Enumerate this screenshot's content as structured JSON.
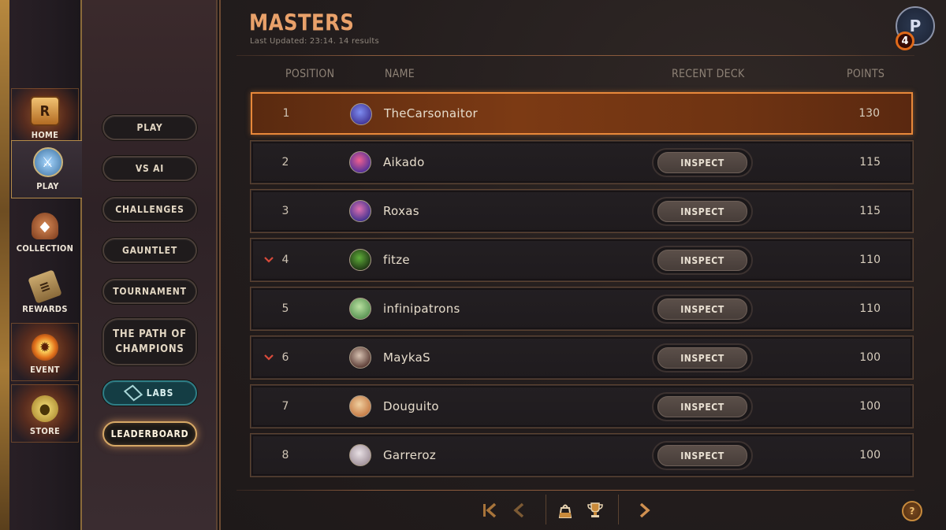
{
  "nav": {
    "items": [
      {
        "label": "HOME",
        "icon": "home-icon",
        "glyph": "R"
      },
      {
        "label": "PLAY",
        "icon": "play-shield-icon",
        "glyph": "⚔"
      },
      {
        "label": "COLLECTION",
        "icon": "collection-bag-icon",
        "glyph": "◆"
      },
      {
        "label": "REWARDS",
        "icon": "rewards-scroll-icon",
        "glyph": "≡"
      },
      {
        "label": "EVENT",
        "icon": "event-sun-icon",
        "glyph": "✹"
      },
      {
        "label": "STORE",
        "icon": "store-coins-icon",
        "glyph": "●"
      }
    ]
  },
  "submenu": {
    "play": "PLAY",
    "vs_ai": "VS AI",
    "challenges": "CHALLENGES",
    "gauntlet": "GAUNTLET",
    "tournament": "TOURNAMENT",
    "path_line1": "THE PATH OF",
    "path_line2": "CHAMPIONS",
    "labs": "LABS",
    "leaderboard": "LEADERBOARD"
  },
  "header": {
    "title": "MASTERS",
    "subtitle": "Last Updated: 23:14. 14 results",
    "profile_glyph": "P",
    "notification_count": "4"
  },
  "columns": {
    "position": "POSITION",
    "name": "NAME",
    "recent_deck": "RECENT DECK",
    "points": "POINTS"
  },
  "inspect_label": "INSPECT",
  "rows": [
    {
      "position": "1",
      "name": "TheCarsonaitor",
      "points": "130",
      "trend": "",
      "highlight": true,
      "avatar_colors": [
        "#7d8cf0",
        "#3b2a8a"
      ]
    },
    {
      "position": "2",
      "name": "Aikado",
      "points": "115",
      "trend": "",
      "highlight": false,
      "avatar_colors": [
        "#f06090",
        "#3a2a9a"
      ]
    },
    {
      "position": "3",
      "name": "Roxas",
      "points": "115",
      "trend": "",
      "highlight": false,
      "avatar_colors": [
        "#e070b0",
        "#2a2a8a"
      ]
    },
    {
      "position": "4",
      "name": "fitze",
      "points": "110",
      "trend": "down",
      "highlight": false,
      "avatar_colors": [
        "#5fae3a",
        "#16250f"
      ]
    },
    {
      "position": "5",
      "name": "infinipatrons",
      "points": "110",
      "trend": "",
      "highlight": false,
      "avatar_colors": [
        "#b9e0a0",
        "#4e8a4a"
      ]
    },
    {
      "position": "6",
      "name": "MaykaS",
      "points": "100",
      "trend": "down",
      "highlight": false,
      "avatar_colors": [
        "#d7c2b2",
        "#4a2a24"
      ]
    },
    {
      "position": "7",
      "name": "Douguito",
      "points": "100",
      "trend": "",
      "highlight": false,
      "avatar_colors": [
        "#f0d0a0",
        "#c0703a"
      ]
    },
    {
      "position": "8",
      "name": "Garreroz",
      "points": "100",
      "trend": "",
      "highlight": false,
      "avatar_colors": [
        "#e8e0e4",
        "#9a8a94"
      ]
    }
  ],
  "pager": {
    "first": "first-page-icon",
    "prev": "prev-page-icon",
    "bag": "bag-icon",
    "trophy": "trophy-icon",
    "next": "next-page-icon",
    "help": "?"
  }
}
